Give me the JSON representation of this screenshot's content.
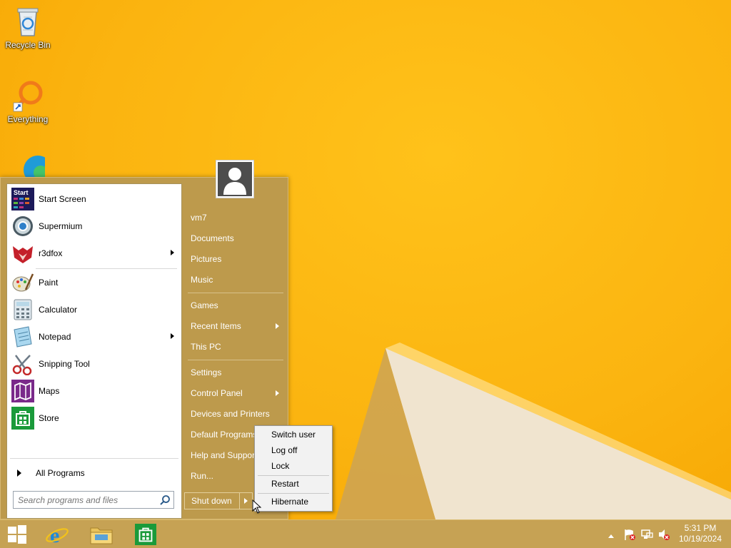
{
  "desktop_icons": [
    {
      "label": "Recycle Bin",
      "icon": "recycle-bin-icon"
    },
    {
      "label": "Everything",
      "icon": "everything-search-icon"
    },
    {
      "label": "",
      "icon": "edge-icon"
    }
  ],
  "start_menu": {
    "programs": [
      {
        "label": "Start Screen",
        "icon": "start-screen-icon",
        "submenu": false
      },
      {
        "label": "Supermium",
        "icon": "supermium-icon",
        "submenu": false
      },
      {
        "label": "r3dfox",
        "icon": "r3dfox-icon",
        "submenu": true
      },
      {
        "label": "Paint",
        "icon": "paint-icon",
        "submenu": false
      },
      {
        "label": "Calculator",
        "icon": "calculator-icon",
        "submenu": false
      },
      {
        "label": "Notepad",
        "icon": "notepad-icon",
        "submenu": true
      },
      {
        "label": "Snipping Tool",
        "icon": "snipping-tool-icon",
        "submenu": false
      },
      {
        "label": "Maps",
        "icon": "maps-icon",
        "submenu": false
      },
      {
        "label": "Store",
        "icon": "store-icon",
        "submenu": false
      }
    ],
    "start_screen_icon_text": "Start",
    "all_programs": "All Programs",
    "search_placeholder": "Search programs and files",
    "right_items": [
      {
        "label": "vm7",
        "submenu": false
      },
      {
        "label": "Documents",
        "submenu": false
      },
      {
        "label": "Pictures",
        "submenu": false
      },
      {
        "label": "Music",
        "submenu": false
      },
      {
        "label": "Games",
        "submenu": false
      },
      {
        "label": "Recent Items",
        "submenu": true
      },
      {
        "label": "This PC",
        "submenu": false
      },
      {
        "label": "Settings",
        "submenu": false
      },
      {
        "label": "Control Panel",
        "submenu": true
      },
      {
        "label": "Devices and Printers",
        "submenu": false
      },
      {
        "label": "Default Programs",
        "submenu": false
      },
      {
        "label": "Help and Support",
        "submenu": false
      },
      {
        "label": "Run...",
        "submenu": false
      }
    ],
    "shutdown_label": "Shut down"
  },
  "power_submenu": {
    "items": [
      "Switch user",
      "Log off",
      "Lock",
      "Restart",
      "Hibernate"
    ]
  },
  "taskbar": {
    "pinned": [
      {
        "icon": "start-button-icon"
      },
      {
        "icon": "internet-explorer-icon"
      },
      {
        "icon": "file-explorer-icon"
      },
      {
        "icon": "store-icon"
      }
    ],
    "clock_time": "5:31 PM",
    "clock_date": "10/19/2024"
  },
  "colors": {
    "wallpaper": "#fbb410",
    "menu_bg": "#bd9a4c",
    "taskbar_bg": "#c6a254"
  }
}
